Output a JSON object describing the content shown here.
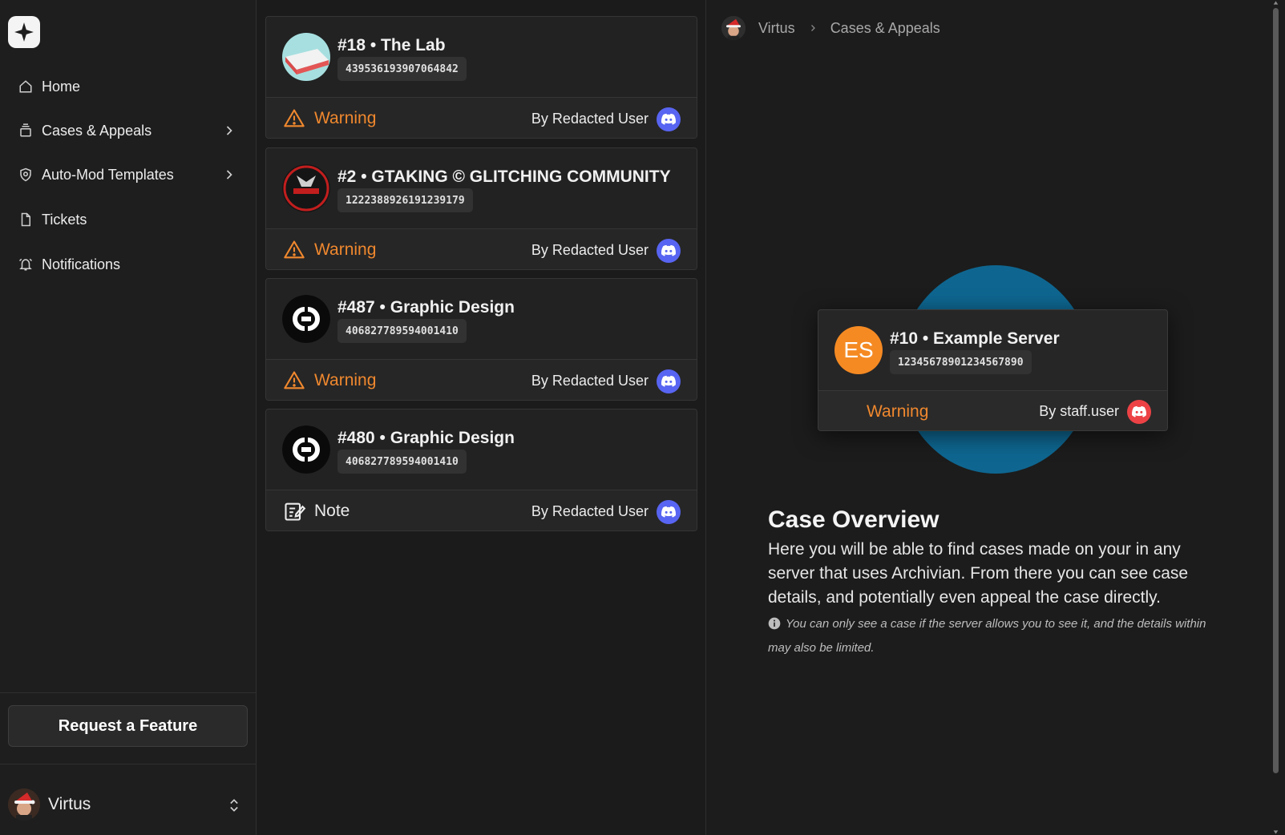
{
  "sidebar": {
    "nav": [
      {
        "label": "Home",
        "icon": "home-icon"
      },
      {
        "label": "Cases & Appeals",
        "icon": "cases-icon",
        "has_submenu": true
      },
      {
        "label": "Auto-Mod Templates",
        "icon": "shield-icon",
        "has_submenu": true
      },
      {
        "label": "Tickets",
        "icon": "file-icon"
      },
      {
        "label": "Notifications",
        "icon": "bell-icon"
      }
    ],
    "feature_button": "Request a Feature",
    "user_name": "Virtus"
  },
  "cases": [
    {
      "title": "#18 • The Lab",
      "id": "439536193907064842",
      "type": "Warning",
      "by": "By Redacted User",
      "icon": "the-lab-server-icon"
    },
    {
      "title": "#2 • GTAKING © GLITCHING COMMUNITY",
      "id": "1222388926191239179",
      "type": "Warning",
      "by": "By Redacted User",
      "icon": "gtaking-server-icon"
    },
    {
      "title": "#487 • Graphic Design",
      "id": "406827789594001410",
      "type": "Warning",
      "by": "By Redacted User",
      "icon": "graphic-design-server-icon"
    },
    {
      "title": "#480 • Graphic Design",
      "id": "406827789594001410",
      "type": "Note",
      "by": "By Redacted User",
      "icon": "graphic-design-server-icon"
    }
  ],
  "breadcrumb": {
    "user": "Virtus",
    "page": "Cases & Appeals"
  },
  "preview": {
    "initials": "ES",
    "title": "#10 • Example Server",
    "id": "12345678901234567890",
    "type": "Warning",
    "by": "By staff.user"
  },
  "overview": {
    "title": "Case Overview",
    "text": "Here you will be able to find cases made on your in any server that uses Archivian. From there you can see case details, and potentially even appeal the case directly.",
    "note": "You can only see a case if the server allows you to see it, and the details within may also be limited."
  },
  "colors": {
    "warning": "#f0882e",
    "discord": "#5865f2",
    "discord_alt": "#ed4245",
    "accent_blob": "#0e6690",
    "es_avatar": "#f58a23"
  }
}
